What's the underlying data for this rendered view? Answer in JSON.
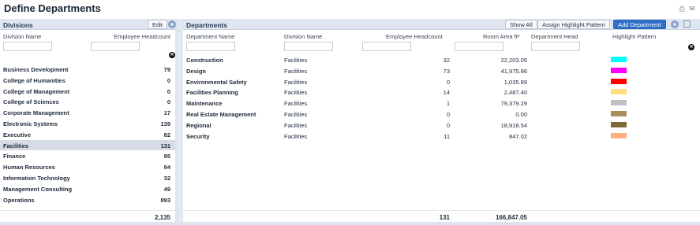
{
  "page": {
    "title": "Define Departments"
  },
  "divisions": {
    "title": "Divisions",
    "edit_label": "Edit",
    "col_name": "Division Name",
    "col_headcount": "Employee Headcount",
    "rows": [
      {
        "name": "Business Development",
        "headcount": "79"
      },
      {
        "name": "College of Humanities",
        "headcount": "0"
      },
      {
        "name": "College of Management",
        "headcount": "0"
      },
      {
        "name": "College of Sciences",
        "headcount": "0"
      },
      {
        "name": "Corporate Management",
        "headcount": "17"
      },
      {
        "name": "Electronic Systems",
        "headcount": "139"
      },
      {
        "name": "Executive",
        "headcount": "82"
      },
      {
        "name": "Facilities",
        "headcount": "131",
        "selected": true
      },
      {
        "name": "Finance",
        "headcount": "95"
      },
      {
        "name": "Human Resources",
        "headcount": "94"
      },
      {
        "name": "Information Technology",
        "headcount": "32"
      },
      {
        "name": "Management Consulting",
        "headcount": "49"
      },
      {
        "name": "Operations",
        "headcount": "893"
      }
    ],
    "total_headcount": "2,135"
  },
  "departments": {
    "title": "Departments",
    "show_all_label": "Show All",
    "assign_label": "Assign Highlight Pattern",
    "add_label": "Add Department",
    "col_dept": "Department Name",
    "col_division": "Division Name",
    "col_headcount": "Employee Headcount",
    "col_area": "Room Area ft²",
    "col_head": "Department Head",
    "col_pattern": "Highlight Pattern",
    "rows": [
      {
        "name": "Construction",
        "division": "Facilities",
        "headcount": "32",
        "area": "22,203.05",
        "color": "#00ffff"
      },
      {
        "name": "Design",
        "division": "Facilities",
        "headcount": "73",
        "area": "41,975.86",
        "color": "#ff00ff"
      },
      {
        "name": "Environmental Safety",
        "division": "Facilities",
        "headcount": "0",
        "area": "1,035.89",
        "color": "#ff0000"
      },
      {
        "name": "Facilities Planning",
        "division": "Facilities",
        "headcount": "14",
        "area": "2,487.40",
        "color": "#ffe080"
      },
      {
        "name": "Maintenance",
        "division": "Facilities",
        "headcount": "1",
        "area": "79,379.29",
        "color": "#c0c0c0"
      },
      {
        "name": "Real Estate Management",
        "division": "Facilities",
        "headcount": "0",
        "area": "0.00",
        "color": "#a89058"
      },
      {
        "name": "Regional",
        "division": "Facilities",
        "headcount": "0",
        "area": "18,918.54",
        "color": "#806838"
      },
      {
        "name": "Security",
        "division": "Facilities",
        "headcount": "11",
        "area": "847.02",
        "color": "#ffb080"
      }
    ],
    "total_headcount": "131",
    "total_area": "166,847.05"
  }
}
